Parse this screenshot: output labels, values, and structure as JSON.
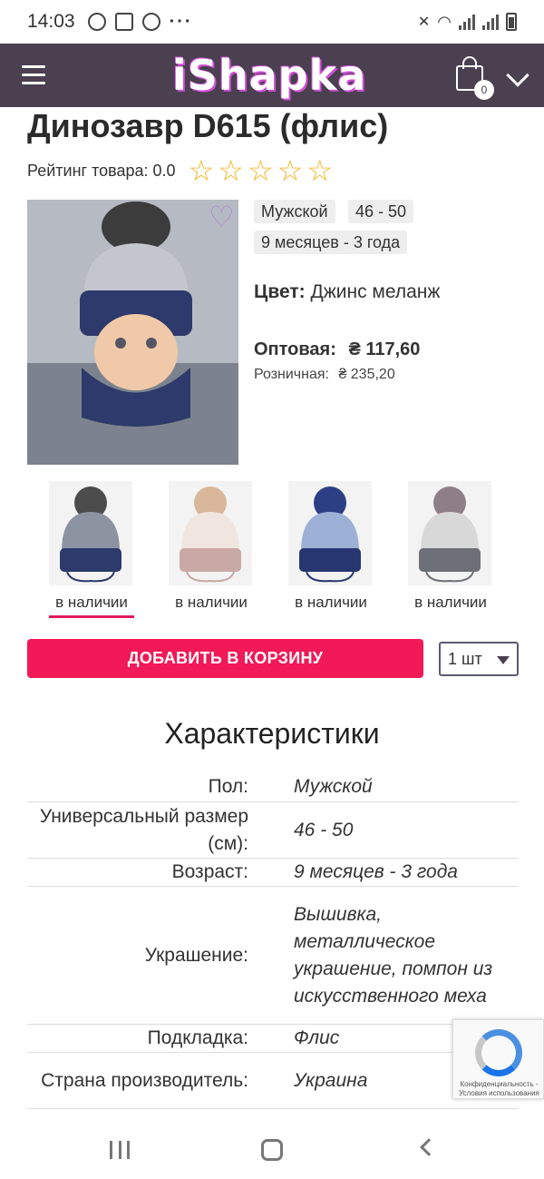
{
  "status": {
    "time": "14:03"
  },
  "header": {
    "logo": "iShapka",
    "cart_count": "0"
  },
  "product": {
    "title": "Динозавр D615 (флис)",
    "rating_label": "Рейтинг товара: 0.0",
    "tags": [
      "Мужской",
      "46 - 50",
      "9 месяцев - 3 года"
    ],
    "color_label": "Цвет:",
    "color_value": "Джинс меланж",
    "wholesale_label": "Оптовая:",
    "wholesale_price": "₴ 117,60",
    "retail_label": "Розничная:",
    "retail_price": "₴ 235,20"
  },
  "variants": [
    {
      "label": "в наличии",
      "hat": "#8c93a1",
      "band": "#2d3a6b",
      "pom": "#4c4c4c"
    },
    {
      "label": "в наличии",
      "hat": "#f1e6df",
      "band": "#c9a9a6",
      "pom": "#d9b79a"
    },
    {
      "label": "в наличии",
      "hat": "#9db1d6",
      "band": "#283670",
      "pom": "#2c3f85"
    },
    {
      "label": "в наличии",
      "hat": "#d8d8d8",
      "band": "#6c6f76",
      "pom": "#8e7e86"
    }
  ],
  "actions": {
    "add_to_cart": "ДОБАВИТЬ В КОРЗИНУ",
    "qty": "1 шт"
  },
  "specs": {
    "heading": "Характеристики",
    "rows": [
      {
        "k": "Пол:",
        "v": "Мужской"
      },
      {
        "k": "Универсальный размер (см):",
        "v": "46 - 50"
      },
      {
        "k": "Возраст:",
        "v": "9 месяцев - 3 года"
      },
      {
        "k": "Украшение:",
        "v": "Вышивка, металлическое украшение, помпон из искусственного меха"
      },
      {
        "k": "Подкладка:",
        "v": "Флис"
      },
      {
        "k": "Страна производитель:",
        "v": "Украина"
      }
    ]
  },
  "recaptcha": {
    "text": "Конфиденциальность - Условия использования"
  },
  "colors": {
    "header": "#4a4050",
    "accent": "#f11957",
    "star": "#f2b31d"
  }
}
